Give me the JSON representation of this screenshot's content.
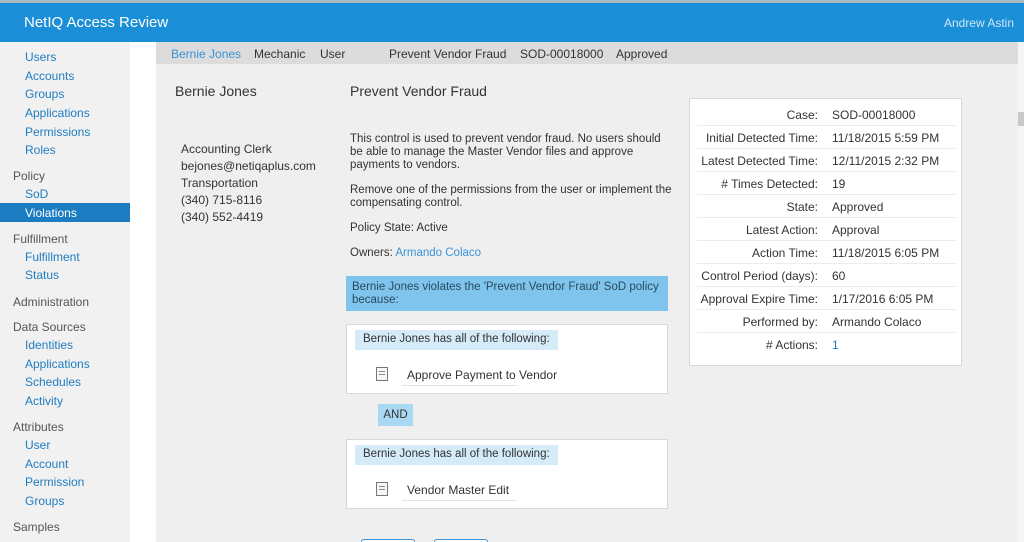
{
  "app": {
    "title": "NetIQ Access Review",
    "user": "Andrew Astin"
  },
  "sidebar": {
    "top_items": [
      "Users",
      "Accounts",
      "Groups",
      "Applications",
      "Permissions",
      "Roles"
    ],
    "policy": {
      "header": "Policy",
      "items": [
        "SoD",
        "Violations"
      ]
    },
    "fulfillment": {
      "header": "Fulfillment",
      "items": [
        "Fulfillment",
        "Status"
      ]
    },
    "administration": {
      "header": "Administration"
    },
    "data_sources": {
      "header": "Data Sources",
      "items": [
        "Identities",
        "Applications",
        "Schedules",
        "Activity"
      ]
    },
    "attributes": {
      "header": "Attributes",
      "items": [
        "User",
        "Account",
        "Permission",
        "Groups"
      ]
    },
    "samples": {
      "header": "Samples"
    }
  },
  "breadcrumb": {
    "user": "Bernie Jones",
    "title": "Mechanic",
    "type": "User",
    "policy": "Prevent Vendor Fraud",
    "case": "SOD-00018000",
    "state": "Approved"
  },
  "user_panel": {
    "name": "Bernie Jones",
    "job_title": "Accounting Clerk",
    "email": "bejones@netiqaplus.com",
    "department": "Transportation",
    "phone1": "(340) 715-8116",
    "phone2": "(340) 552-4419"
  },
  "policy": {
    "name": "Prevent Vendor Fraud",
    "description": "This control is used to prevent vendor fraud. No users should be able to manage the Master Vendor files and approve payments to vendors.",
    "remediation": "Remove one of the permissions from the user or implement the compensating control.",
    "state": "Policy State: Active",
    "owners_label": "Owners:",
    "owner": "Armando Colaco",
    "violation_message": "Bernie Jones violates the 'Prevent Vendor Fraud' SoD policy because:",
    "rules": [
      {
        "header": "Bernie Jones has all of the following:",
        "permission": "Approve Payment to Vendor",
        "icon": "permission-doc-icon"
      },
      {
        "header": "Bernie Jones has all of the following:",
        "permission": "Vendor Master Edit",
        "icon": "permission-doc-icon"
      }
    ],
    "operator": "AND"
  },
  "case_details": [
    {
      "label": "Case:",
      "value": "SOD-00018000"
    },
    {
      "label": "Initial Detected Time:",
      "value": "11/18/2015 5:59 PM"
    },
    {
      "label": "Latest Detected Time:",
      "value": "12/11/2015 2:32 PM"
    },
    {
      "label": "# Times Detected:",
      "value": "19"
    },
    {
      "label": "State:",
      "value": "Approved"
    },
    {
      "label": "Latest Action:",
      "value": "Approval"
    },
    {
      "label": "Action Time:",
      "value": "11/18/2015 6:05 PM"
    },
    {
      "label": "Control Period (days):",
      "value": "60"
    },
    {
      "label": "Approval Expire Time:",
      "value": "1/17/2016 6:05 PM"
    },
    {
      "label": "Performed by:",
      "value": "Armando Colaco"
    },
    {
      "label": "# Actions:",
      "value": "1"
    }
  ],
  "colors": {
    "header": "#1a8fd7",
    "active_nav": "#1c7cc2",
    "link": "#1f7cc0",
    "violation_bg": "#7ec4ec",
    "chip_bg": "#d5ebf8"
  }
}
